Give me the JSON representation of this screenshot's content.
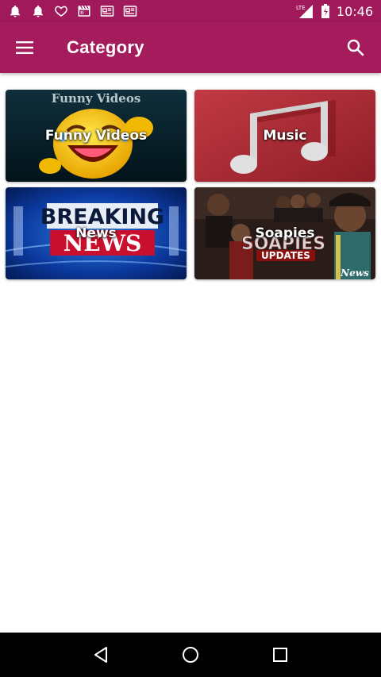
{
  "status_bar": {
    "time": "10:46",
    "network": "LTE",
    "left_icons": [
      "notification-bell-icon",
      "notification-bell-icon",
      "heart-icon",
      "clapperboard-icon",
      "newspaper-icon",
      "newspaper-icon"
    ],
    "right_icons": [
      "lte-signal-icon",
      "battery-charging-icon"
    ]
  },
  "app_bar": {
    "title": "Category",
    "menu_icon": "hamburger-menu-icon",
    "search_icon": "search-icon",
    "color": "#a41c5c"
  },
  "categories": [
    {
      "label": "Funny Videos",
      "image_text": "Funny Videos"
    },
    {
      "label": "Music"
    },
    {
      "label": "News",
      "image_text_1": "BREAKING",
      "image_text_2": "NEWS"
    },
    {
      "label": "Soapies",
      "image_text_1": "SOAPIES",
      "image_text_2": "UPDATES",
      "image_text_3": "News"
    }
  ],
  "nav_bar": {
    "buttons": [
      "back-icon",
      "home-icon",
      "recents-icon"
    ]
  }
}
